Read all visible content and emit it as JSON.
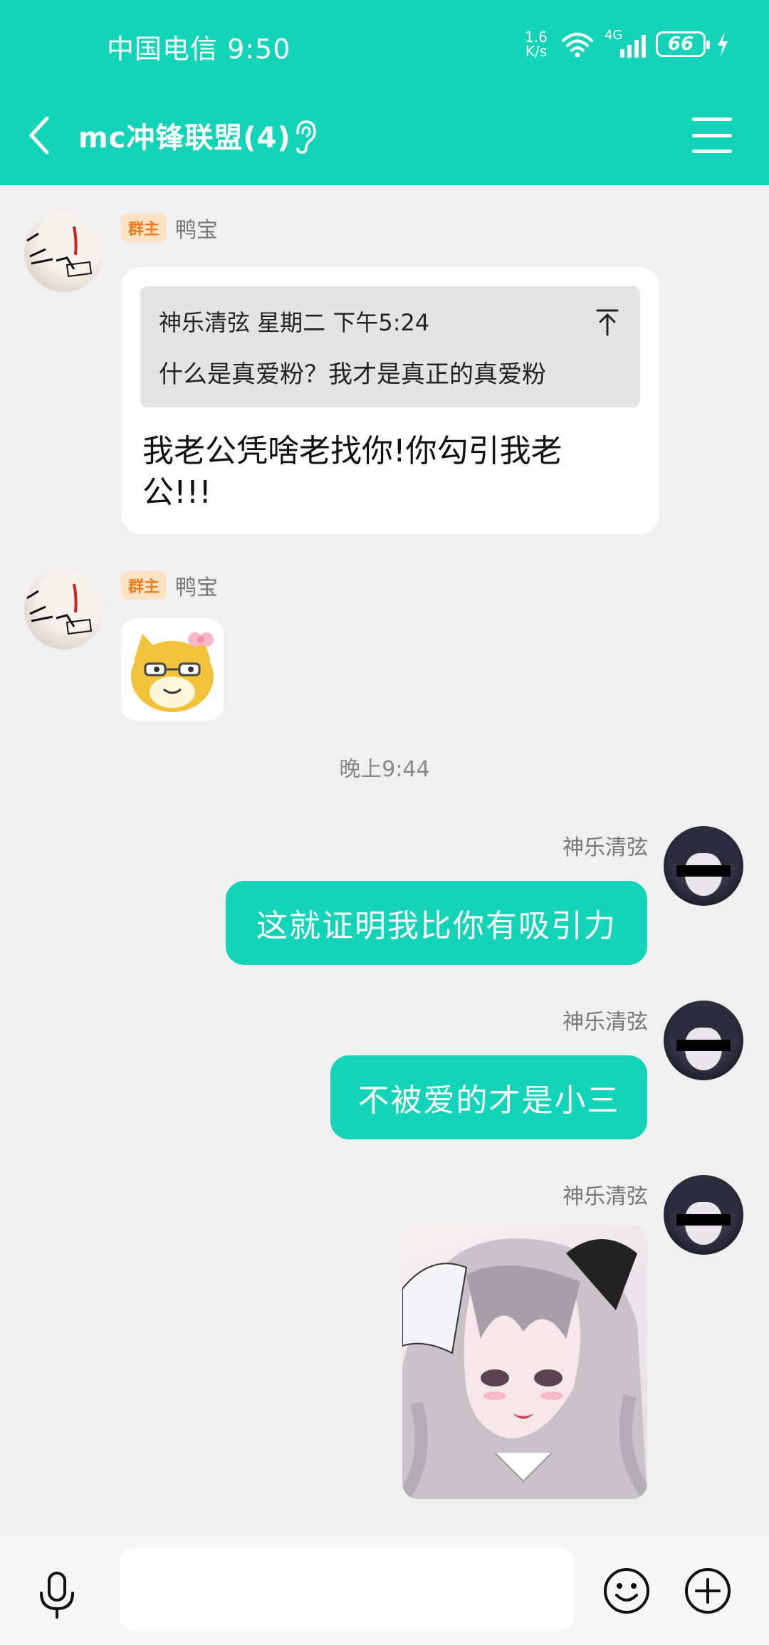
{
  "status_bar": {
    "carrier_time": "中国电信 9:50",
    "net_speed_value": "1.6",
    "net_speed_unit": "K/s",
    "network_type": "4G",
    "battery": "66"
  },
  "header": {
    "title": "mc冲锋联盟(4)"
  },
  "messages": [
    {
      "sender": "鸭宝",
      "badge": "群主",
      "quote_meta": "神乐清弦 星期二 下午5:24",
      "quote_text": "什么是真爱粉？我才是真正的真爱粉",
      "text": "我老公凭啥老找你!你勾引我老公!!!"
    },
    {
      "sender": "鸭宝",
      "badge": "群主",
      "type": "sticker"
    },
    {
      "divider": "晚上9:44"
    },
    {
      "sender": "神乐清弦",
      "text": "这就证明我比你有吸引力"
    },
    {
      "sender": "神乐清弦",
      "text": "不被爱的才是小三"
    },
    {
      "sender": "神乐清弦",
      "type": "image"
    }
  ],
  "input": {
    "value": ""
  },
  "colors": {
    "accent": "#13d4b8",
    "background": "#f0f0f0",
    "badge_bg": "#ffe3c4",
    "badge_text": "#f07a1a"
  },
  "icons": [
    "back-arrow-icon",
    "ear-icon",
    "menu-icon",
    "reply-up-icon",
    "mic-icon",
    "emoji-icon",
    "plus-icon"
  ]
}
